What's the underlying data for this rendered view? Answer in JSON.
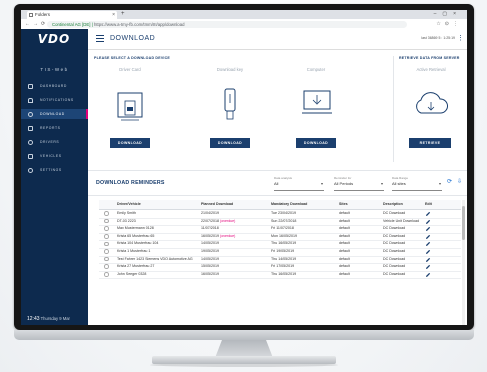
{
  "browser": {
    "tab_title": "Folders",
    "url_secure": "Continental AG [DE] |",
    "url_rest": "https://www.a-tmy-fb.com/tmm/III/app/download"
  },
  "app": {
    "brand": "VDO",
    "sidebar_title": "TIS-Web",
    "page_title": "DOWNLOAD",
    "last_sync": "last 36869 5 : 1:25:19",
    "time": "12:43",
    "time_suffix": "Thursday 9 Mar"
  },
  "sidebar": {
    "items": [
      {
        "label": "DASHBOARD",
        "icon": "dashboard-icon"
      },
      {
        "label": "NOTIFICATIONS",
        "icon": "bell-icon"
      },
      {
        "label": "DOWNLOAD",
        "icon": "user-icon",
        "active": true
      },
      {
        "label": "REPORTS",
        "icon": "report-icon"
      },
      {
        "label": "DRIVERS",
        "icon": "driver-icon"
      },
      {
        "label": "VEHICLES",
        "icon": "truck-icon"
      },
      {
        "label": "SETTINGS",
        "icon": "gear-icon"
      }
    ]
  },
  "download_panel": {
    "title": "PLEASE SELECT A DOWNLOAD DEVICE",
    "options": [
      {
        "label": "Driver Card",
        "button": "DOWNLOAD"
      },
      {
        "label": "Download key",
        "button": "DOWNLOAD"
      },
      {
        "label": "Computer",
        "button": "DOWNLOAD"
      }
    ]
  },
  "retrieve_panel": {
    "title": "RETRIEVE DATA FROM SERVER",
    "label": "Active Retrieval",
    "button": "RETRIEVE"
  },
  "reminders": {
    "title": "DOWNLOAD REMINDERS",
    "filters": [
      {
        "label": "Data analysis",
        "value": "All"
      },
      {
        "label": "Reminder for",
        "value": "All Periods"
      },
      {
        "label": "Data Range",
        "value": "All sites"
      }
    ],
    "columns": [
      "Driver/Vehicle",
      "Planned Download",
      "Mandatory Download",
      "Sites",
      "Description",
      "Edit"
    ],
    "rows": [
      {
        "name": "Emily Smith",
        "planned": "21/04/2019",
        "overdue": "",
        "mandatory": "Tue 23/04/2019",
        "site": "default",
        "desc": "DC Download"
      },
      {
        "name": "DT-03 2223",
        "planned": "22/07/2018",
        "overdue": "(overdue)",
        "mandatory": "Sun 22/07/2018",
        "site": "default",
        "desc": "Vehicle Unit Download"
      },
      {
        "name": "Max Mustermann 0128",
        "planned": "11/07/2018",
        "overdue": "",
        "mandatory": "Fri 11/07/2018",
        "site": "default",
        "desc": "DC Download"
      },
      {
        "name": "Krista 65 Musterfrau 65",
        "planned": "16/05/2019",
        "overdue": "(overdue)",
        "mandatory": "Mon 16/05/2019",
        "site": "default",
        "desc": "DC Download"
      },
      {
        "name": "Krista 104 Musterfrau 104",
        "planned": "14/05/2019",
        "overdue": "",
        "mandatory": "Thu 16/05/2019",
        "site": "default",
        "desc": "DC Download"
      },
      {
        "name": "Krista 1 Musterfrau 1",
        "planned": "19/05/2019",
        "overdue": "",
        "mandatory": "Fri 19/05/2019",
        "site": "default",
        "desc": "DC Download"
      },
      {
        "name": "Test Fahrer 1423 Siemens VDO Automotive AG",
        "planned": "14/05/2019",
        "overdue": "",
        "mandatory": "Thu 14/05/2019",
        "site": "default",
        "desc": "DC Download"
      },
      {
        "name": "Krista 27 Musterfrau 27",
        "planned": "15/05/2019",
        "overdue": "",
        "mandatory": "Fri 17/05/2019",
        "site": "default",
        "desc": "DC Download"
      },
      {
        "name": "John Seeger 0328",
        "planned": "16/05/2019",
        "overdue": "",
        "mandatory": "Thu 16/05/2019",
        "site": "default",
        "desc": "DC Download"
      }
    ]
  }
}
